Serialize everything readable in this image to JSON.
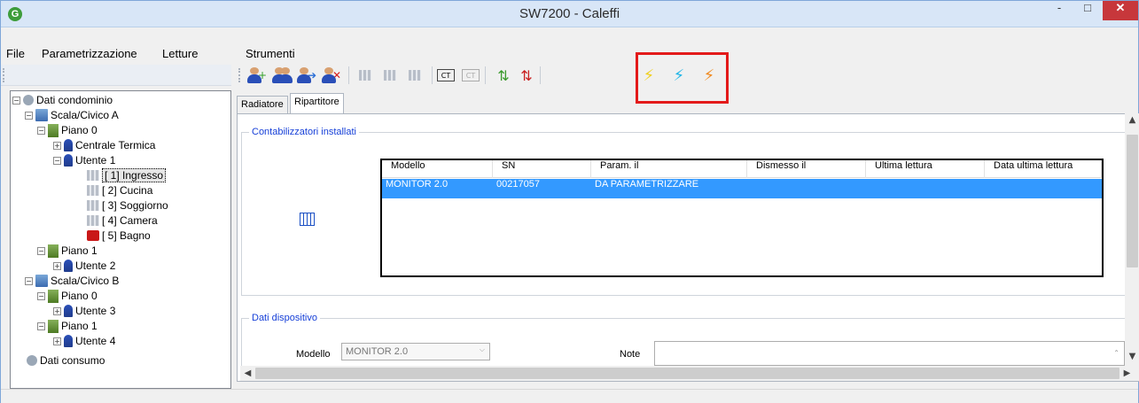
{
  "window": {
    "title": "SW7200 - Caleffi",
    "app_icon": "caleffi-logo-icon",
    "minimize": "-",
    "maximize": "□",
    "close": "✕"
  },
  "menu": {
    "items": [
      "File",
      "Parametrizzazione",
      "Letture",
      "Strumenti"
    ]
  },
  "toolbar": {
    "buttons": [
      {
        "name": "add-user-icon"
      },
      {
        "name": "users-icon"
      },
      {
        "name": "user-move-icon"
      },
      {
        "name": "remove-user-icon"
      },
      {
        "name": "add-radiator-icon"
      },
      {
        "name": "edit-radiator-icon"
      },
      {
        "name": "remove-radiator-icon"
      },
      {
        "name": "ct-add-icon"
      },
      {
        "name": "ct-disabled-icon"
      },
      {
        "name": "meter-add-icon"
      },
      {
        "name": "meter-remove-icon"
      },
      {
        "name": "lightning-yellow-icon"
      },
      {
        "name": "lightning-cyan-icon"
      },
      {
        "name": "lightning-orange-icon"
      }
    ]
  },
  "tree": [
    {
      "label": "Dati condominio",
      "icon": "condominium-icon"
    },
    {
      "label": "Scala/Civico A",
      "icon": "building-icon"
    },
    {
      "label": "Piano  0",
      "icon": "floor-icon"
    },
    {
      "label": "Centrale Termica",
      "icon": "user-icon"
    },
    {
      "label": "Utente 1",
      "icon": "user-icon"
    },
    {
      "label": "[ 1] Ingresso",
      "icon": "radiator-icon"
    },
    {
      "label": "[ 2] Cucina",
      "icon": "radiator-icon"
    },
    {
      "label": "[ 3] Soggiorno",
      "icon": "radiator-icon"
    },
    {
      "label": "[ 4] Camera",
      "icon": "radiator-icon"
    },
    {
      "label": "[ 5] Bagno",
      "icon": "radiator-red-icon"
    },
    {
      "label": "Piano  1",
      "icon": "floor-icon"
    },
    {
      "label": "Utente 2",
      "icon": "user-icon"
    },
    {
      "label": "Scala/Civico B",
      "icon": "building-icon"
    },
    {
      "label": "Piano  0",
      "icon": "floor-icon"
    },
    {
      "label": "Utente 3",
      "icon": "user-icon"
    },
    {
      "label": "Piano  1",
      "icon": "floor-icon"
    },
    {
      "label": "Utente 4",
      "icon": "user-icon"
    },
    {
      "label": "Dati consumo",
      "icon": "consumption-icon"
    }
  ],
  "tabs": [
    "Radiatore",
    "Ripartitore"
  ],
  "groups": {
    "installed": "Contabilizzatori installati",
    "device": "Dati dispositivo"
  },
  "table": {
    "columns": [
      "Modello",
      "SN",
      "Param. il",
      "Dismesso il",
      "Ultima lettura",
      "Data ultima lettura"
    ],
    "rows": [
      [
        "MONITOR 2.0",
        "00217057",
        "DA PARAMETRIZZARE",
        "",
        "",
        ""
      ]
    ]
  },
  "device": {
    "model_label": "Modello",
    "model_value": "MONITOR 2.0",
    "note_label": "Note",
    "note_value": ""
  }
}
